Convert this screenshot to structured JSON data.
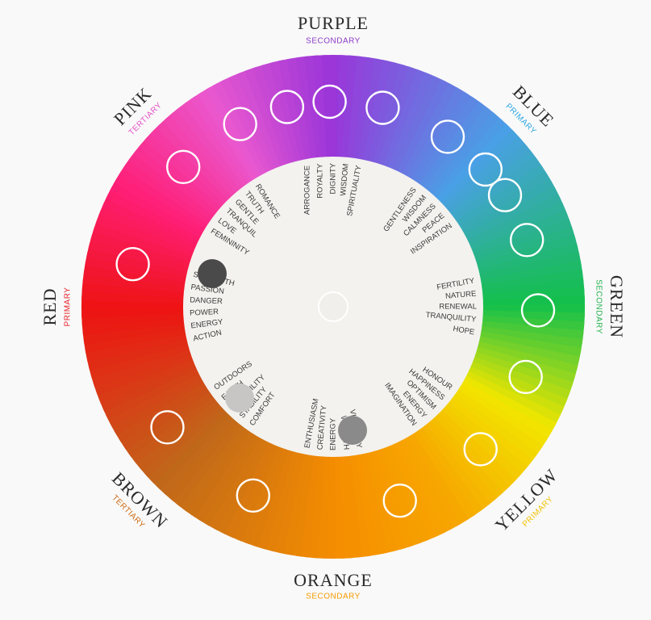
{
  "colors": [
    {
      "id": "purple",
      "name": "PURPLE",
      "category": "SECONDARY",
      "category_color": "#8d3cc9",
      "words": [
        "ARROGANCE",
        "ROYALTY",
        "DIGNITY",
        "WISDOM",
        "SPIRITUALITY"
      ]
    },
    {
      "id": "blue",
      "name": "BLUE",
      "category": "PRIMARY",
      "category_color": "#2aa6e2",
      "words": [
        "GENTLENESS",
        "WISDOM",
        "CALMNESS",
        "PEACE",
        "INSPIRATION"
      ]
    },
    {
      "id": "green",
      "name": "GREEN",
      "category": "SECONDARY",
      "category_color": "#23b14d",
      "words": [
        "FERTILITY",
        "NATURE",
        "RENEWAL",
        "TRANQUILITY",
        "HOPE"
      ]
    },
    {
      "id": "yellow",
      "name": "YELLOW",
      "category": "PRIMARY",
      "category_color": "#f2c200",
      "words": [
        "IMAGINATION",
        "ENERGY",
        "OPTIMISM",
        "HAPPINESS",
        "HONOUR"
      ]
    },
    {
      "id": "orange",
      "name": "ORANGE",
      "category": "SECONDARY",
      "category_color": "#f59a00",
      "words": [
        "ENTHUSIASM",
        "CREATIVITY",
        "ENERGY",
        "WARMTH",
        "VIBRANCY"
      ]
    },
    {
      "id": "brown",
      "name": "BROWN",
      "category": "TERTIARY",
      "category_color": "#cd6a12",
      "words": [
        "OUTDOORS",
        "EARTH",
        "RELIABILITY",
        "STABILITY",
        "COMFORT"
      ]
    },
    {
      "id": "red",
      "name": "RED",
      "category": "PRIMARY",
      "category_color": "#e8202a",
      "words": [
        "ACTION",
        "ENERGY",
        "POWER",
        "DANGER",
        "PASSION",
        "STRENGTH"
      ]
    },
    {
      "id": "pink",
      "name": "PINK",
      "category": "TERTIARY",
      "category_color": "#e64ec6",
      "words": [
        "FEMININITY",
        "LOVE",
        "TRANQUIL",
        "GENTLE",
        "TRUTH",
        "ROMANCE"
      ]
    }
  ],
  "drops": [
    {
      "id": "dark-gray",
      "color": "#4a4a4a"
    },
    {
      "id": "light-gray",
      "color": "#c8c6c4"
    },
    {
      "id": "mid-gray",
      "color": "#8a8a8a"
    },
    {
      "id": "center",
      "color": "#f0efeb"
    }
  ]
}
